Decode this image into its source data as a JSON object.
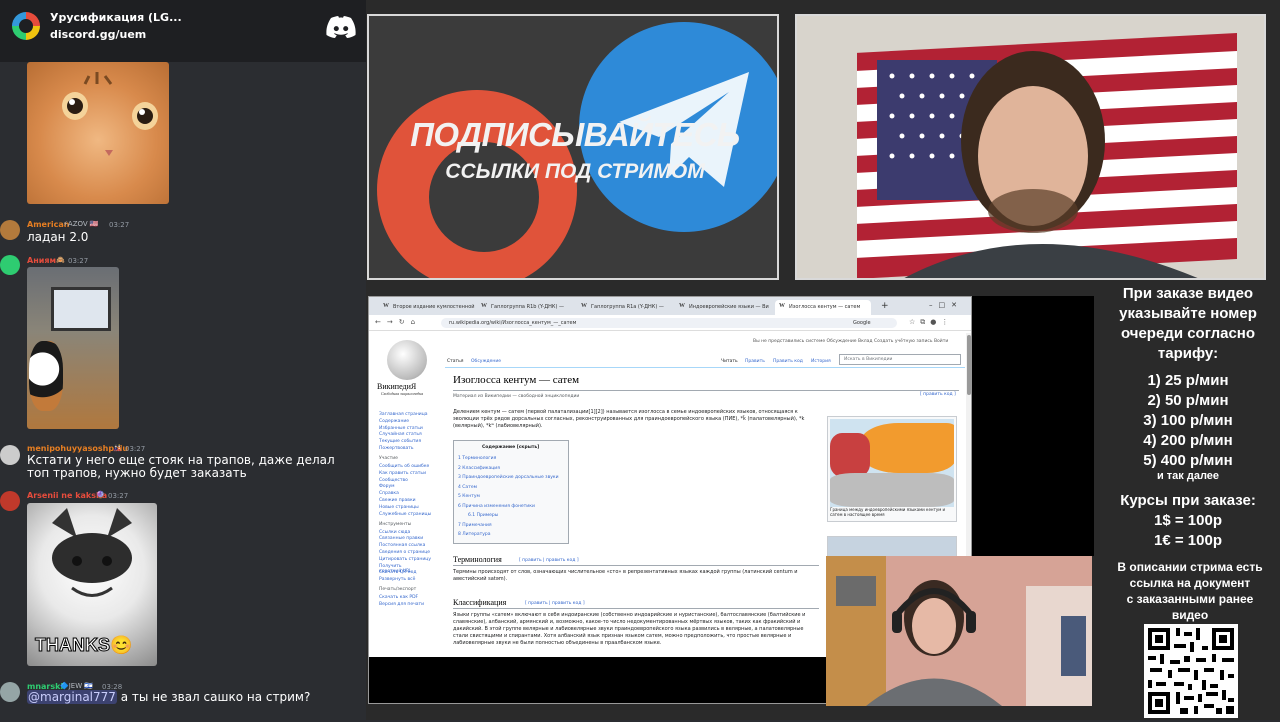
{
  "discord": {
    "server_name": "Урусификация (LG...",
    "invite": "discord.gg/uem"
  },
  "chat": {
    "messages": [
      {
        "user": "American",
        "badges": "AZOV",
        "time": "03:27",
        "text": "ладан 2.0"
      },
      {
        "user": "Аниям",
        "badges": "",
        "time": "03:27",
        "text": ""
      },
      {
        "user": "menipohuyyasoshpolu",
        "badges": "",
        "time": "03:27",
        "text": "Кстати у него еще стояк на трапов, даже делал топ трапов, нужно будет заказать"
      },
      {
        "user": "Arsenii ne kaksha",
        "badges": "",
        "time": "03:27",
        "text": ""
      },
      {
        "user": "mnarski",
        "badges": "JEW",
        "time": "03:28",
        "mention": "@marginal777",
        "text": "а ты не звал сашко на стрим?"
      }
    ],
    "thanks_caption": "THANKS😊"
  },
  "promo": {
    "title": "ПОДПИСЫВАЙТЕСЬ",
    "subtitle": "ССЫЛКИ ПОД СТРИМОМ"
  },
  "browser": {
    "tabs": [
      "Второе издание кумлостенной",
      "Гаплогруппа R1b (Y-ДНК) —",
      "Гаплогруппа R1a (Y-ДНК) —",
      "Индоевропейские языки — Ви",
      "Изоглосса кентум — сатем"
    ],
    "url": "ru.wikipedia.org/wiki/Изоглосса_кентум_—_сатем",
    "google_label": "Google",
    "wiki": {
      "logo_title": "ВикипедиЯ",
      "logo_sub": "Свободная энциклопедия",
      "page_tabs": [
        "Статья",
        "Обсуждение"
      ],
      "view_tabs": [
        "Читать",
        "Править",
        "Править код",
        "История"
      ],
      "search_placeholder": "Искать в Википедии",
      "user_links": "Вы не представились системе  Обсуждение  Вклад  Создать учётную запись  Войти",
      "heading": "Изоглосса кентум — сатем",
      "from": "Материал из Википедии — свободной энциклопедии",
      "edit_link": "[ править код ]",
      "intro": "Делением кентум — сатем (первой палатализации[1][2]) называется изоглосса в семье индоевропейских языков, относящаяся к эволюции трёх рядов дорсальных согласных, реконструированных для праиндоевропейского языка (ПИЕ), *k̑ (палатовелярный), *k (велярный), *kʷ (лабиовелярный).",
      "toc_title": "Содержание [скрыть]",
      "toc": [
        "1 Терминология",
        "2 Классификация",
        "3 Праиндоевропейские дорсальные звуки",
        "4 Сатем",
        "5 Кентум",
        "6 Причина изменения фонетики",
        "6.1 Примеры",
        "7 Примечания",
        "8 Литература"
      ],
      "sidebar": [
        "Заглавная страница",
        "Содержание",
        "Избранные статьи",
        "Случайная статья",
        "Текущие события",
        "Пожертвовать",
        "Участие",
        "Сообщить об ошибке",
        "Как править статьи",
        "Сообщество",
        "Форум",
        "Справка",
        "Свежие правки",
        "Новые страницы",
        "Служебные страницы",
        "Инструменты",
        "Ссылки сюда",
        "Связанные правки",
        "Постоянная ссылка",
        "Сведения о странице",
        "Цитировать страницу",
        "Получить короткий URL",
        "Скачать QR-код",
        "Развернуть всё",
        "Печать/экспорт",
        "Скачать как PDF",
        "Версия для печати"
      ],
      "section1": "Терминология",
      "section1_edit": "[ править | править код ]",
      "section1_text": "Термины происходят от слов, означающих числительное «сто» в репрезентативных языках каждой группы (латинский centum и авестийский satəm).",
      "section2": "Классификация",
      "section2_edit": "[ править | править код ]",
      "section2_text": "Языки группы «сатем» включают в себя индоиранские (собственно индоарийские и нуристанские), балтославянские (балтийские и славянские), албанский, армянский и, возможно, какое-то число недокументированных мёртвых языков, таких как фракийский и дакийский. В этой группе велярные и лабиовелярные звуки праиндоевропейского языка развились в велярные, а палатовелярные стали свистящими и спирантами. Хотя албанский язык признан языком сатем, можно предположить, что простые велярные и лабиовелярные звуки не были полностью объединены в праалбанском языке.",
      "map_caption": "Граница между индоевропейскими языками кентум и сатем в настоящее время"
    }
  },
  "pricing": {
    "intro": [
      "При заказе видео",
      "указывайте номер",
      "очереди согласно",
      "тарифу:"
    ],
    "tiers": [
      "1) 25 р/мин",
      "2) 50 р/мин",
      "3) 100 р/мин",
      "4) 200 р/мин",
      "5) 400 р/мин"
    ],
    "etc": "и так далее",
    "rates_title": "Курсы при заказе:",
    "rates": [
      "1$ = 100р",
      "1€ = 100р"
    ],
    "note": [
      "В описании стрима есть",
      "ссылка на документ",
      "с заказанными ранее",
      "видео"
    ]
  },
  "colors": {
    "discord_bg": "#2b2d31",
    "telegram_blue": "#2e8ad8",
    "rutube_red": "#e0533a",
    "american_name": "#e67e22",
    "aniam_name": "#e74c3c",
    "meni_name": "#e67e22",
    "arsenii_name": "#e74c3c",
    "mnarski_name": "#2ecc71"
  }
}
